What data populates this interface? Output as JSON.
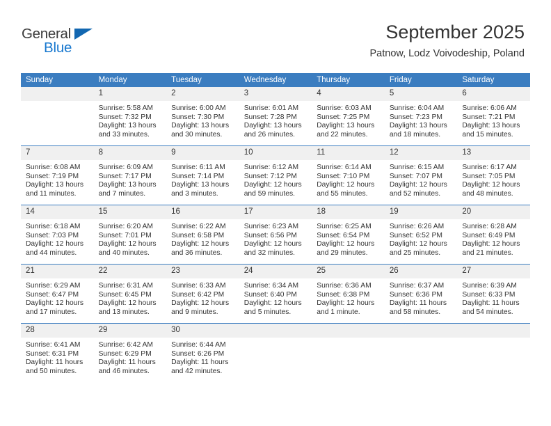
{
  "brand": {
    "name_top": "General",
    "name_bottom": "Blue",
    "accent_color": "#1878cf",
    "triangle_color": "#1267b1"
  },
  "header": {
    "title": "September 2025",
    "subtitle": "Patnow, Lodz Voivodeship, Poland"
  },
  "calendar": {
    "header_bg": "#3b7dc0",
    "daynum_bg": "#f0f0f0",
    "weekday_labels": [
      "Sunday",
      "Monday",
      "Tuesday",
      "Wednesday",
      "Thursday",
      "Friday",
      "Saturday"
    ],
    "weeks": [
      [
        {
          "day": "",
          "lines": []
        },
        {
          "day": "1",
          "lines": [
            "Sunrise: 5:58 AM",
            "Sunset: 7:32 PM",
            "Daylight: 13 hours",
            "and 33 minutes."
          ]
        },
        {
          "day": "2",
          "lines": [
            "Sunrise: 6:00 AM",
            "Sunset: 7:30 PM",
            "Daylight: 13 hours",
            "and 30 minutes."
          ]
        },
        {
          "day": "3",
          "lines": [
            "Sunrise: 6:01 AM",
            "Sunset: 7:28 PM",
            "Daylight: 13 hours",
            "and 26 minutes."
          ]
        },
        {
          "day": "4",
          "lines": [
            "Sunrise: 6:03 AM",
            "Sunset: 7:25 PM",
            "Daylight: 13 hours",
            "and 22 minutes."
          ]
        },
        {
          "day": "5",
          "lines": [
            "Sunrise: 6:04 AM",
            "Sunset: 7:23 PM",
            "Daylight: 13 hours",
            "and 18 minutes."
          ]
        },
        {
          "day": "6",
          "lines": [
            "Sunrise: 6:06 AM",
            "Sunset: 7:21 PM",
            "Daylight: 13 hours",
            "and 15 minutes."
          ]
        }
      ],
      [
        {
          "day": "7",
          "lines": [
            "Sunrise: 6:08 AM",
            "Sunset: 7:19 PM",
            "Daylight: 13 hours",
            "and 11 minutes."
          ]
        },
        {
          "day": "8",
          "lines": [
            "Sunrise: 6:09 AM",
            "Sunset: 7:17 PM",
            "Daylight: 13 hours",
            "and 7 minutes."
          ]
        },
        {
          "day": "9",
          "lines": [
            "Sunrise: 6:11 AM",
            "Sunset: 7:14 PM",
            "Daylight: 13 hours",
            "and 3 minutes."
          ]
        },
        {
          "day": "10",
          "lines": [
            "Sunrise: 6:12 AM",
            "Sunset: 7:12 PM",
            "Daylight: 12 hours",
            "and 59 minutes."
          ]
        },
        {
          "day": "11",
          "lines": [
            "Sunrise: 6:14 AM",
            "Sunset: 7:10 PM",
            "Daylight: 12 hours",
            "and 55 minutes."
          ]
        },
        {
          "day": "12",
          "lines": [
            "Sunrise: 6:15 AM",
            "Sunset: 7:07 PM",
            "Daylight: 12 hours",
            "and 52 minutes."
          ]
        },
        {
          "day": "13",
          "lines": [
            "Sunrise: 6:17 AM",
            "Sunset: 7:05 PM",
            "Daylight: 12 hours",
            "and 48 minutes."
          ]
        }
      ],
      [
        {
          "day": "14",
          "lines": [
            "Sunrise: 6:18 AM",
            "Sunset: 7:03 PM",
            "Daylight: 12 hours",
            "and 44 minutes."
          ]
        },
        {
          "day": "15",
          "lines": [
            "Sunrise: 6:20 AM",
            "Sunset: 7:01 PM",
            "Daylight: 12 hours",
            "and 40 minutes."
          ]
        },
        {
          "day": "16",
          "lines": [
            "Sunrise: 6:22 AM",
            "Sunset: 6:58 PM",
            "Daylight: 12 hours",
            "and 36 minutes."
          ]
        },
        {
          "day": "17",
          "lines": [
            "Sunrise: 6:23 AM",
            "Sunset: 6:56 PM",
            "Daylight: 12 hours",
            "and 32 minutes."
          ]
        },
        {
          "day": "18",
          "lines": [
            "Sunrise: 6:25 AM",
            "Sunset: 6:54 PM",
            "Daylight: 12 hours",
            "and 29 minutes."
          ]
        },
        {
          "day": "19",
          "lines": [
            "Sunrise: 6:26 AM",
            "Sunset: 6:52 PM",
            "Daylight: 12 hours",
            "and 25 minutes."
          ]
        },
        {
          "day": "20",
          "lines": [
            "Sunrise: 6:28 AM",
            "Sunset: 6:49 PM",
            "Daylight: 12 hours",
            "and 21 minutes."
          ]
        }
      ],
      [
        {
          "day": "21",
          "lines": [
            "Sunrise: 6:29 AM",
            "Sunset: 6:47 PM",
            "Daylight: 12 hours",
            "and 17 minutes."
          ]
        },
        {
          "day": "22",
          "lines": [
            "Sunrise: 6:31 AM",
            "Sunset: 6:45 PM",
            "Daylight: 12 hours",
            "and 13 minutes."
          ]
        },
        {
          "day": "23",
          "lines": [
            "Sunrise: 6:33 AM",
            "Sunset: 6:42 PM",
            "Daylight: 12 hours",
            "and 9 minutes."
          ]
        },
        {
          "day": "24",
          "lines": [
            "Sunrise: 6:34 AM",
            "Sunset: 6:40 PM",
            "Daylight: 12 hours",
            "and 5 minutes."
          ]
        },
        {
          "day": "25",
          "lines": [
            "Sunrise: 6:36 AM",
            "Sunset: 6:38 PM",
            "Daylight: 12 hours",
            "and 1 minute."
          ]
        },
        {
          "day": "26",
          "lines": [
            "Sunrise: 6:37 AM",
            "Sunset: 6:36 PM",
            "Daylight: 11 hours",
            "and 58 minutes."
          ]
        },
        {
          "day": "27",
          "lines": [
            "Sunrise: 6:39 AM",
            "Sunset: 6:33 PM",
            "Daylight: 11 hours",
            "and 54 minutes."
          ]
        }
      ],
      [
        {
          "day": "28",
          "lines": [
            "Sunrise: 6:41 AM",
            "Sunset: 6:31 PM",
            "Daylight: 11 hours",
            "and 50 minutes."
          ]
        },
        {
          "day": "29",
          "lines": [
            "Sunrise: 6:42 AM",
            "Sunset: 6:29 PM",
            "Daylight: 11 hours",
            "and 46 minutes."
          ]
        },
        {
          "day": "30",
          "lines": [
            "Sunrise: 6:44 AM",
            "Sunset: 6:26 PM",
            "Daylight: 11 hours",
            "and 42 minutes."
          ]
        },
        {
          "day": "",
          "lines": []
        },
        {
          "day": "",
          "lines": []
        },
        {
          "day": "",
          "lines": []
        },
        {
          "day": "",
          "lines": []
        }
      ]
    ]
  }
}
